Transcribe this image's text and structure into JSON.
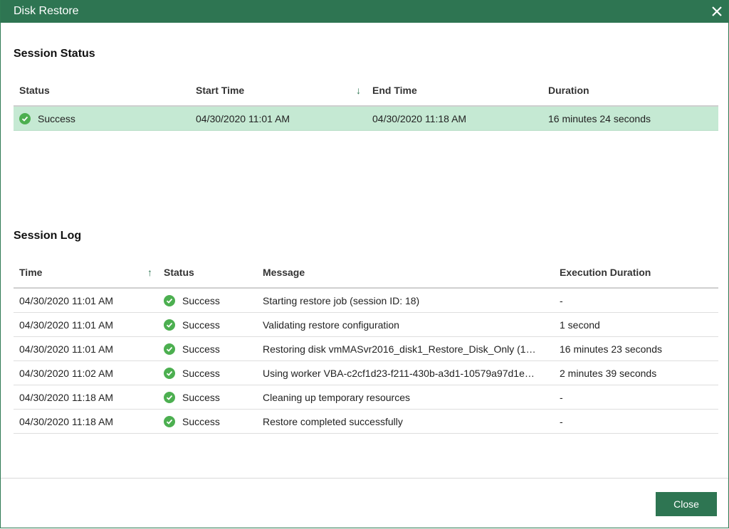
{
  "window": {
    "title": "Disk Restore"
  },
  "session_status": {
    "heading": "Session Status",
    "columns": [
      "Status",
      "Start Time",
      "End Time",
      "Duration"
    ],
    "rows": [
      {
        "status": "Success",
        "start": "04/30/2020 11:01 AM",
        "end": "04/30/2020 11:18 AM",
        "duration": "16 minutes 24 seconds"
      }
    ]
  },
  "session_log": {
    "heading": "Session Log",
    "columns": [
      "Time",
      "Status",
      "Message",
      "Execution Duration"
    ],
    "rows": [
      {
        "time": "04/30/2020 11:01 AM",
        "status": "Success",
        "message": "Starting restore job (session ID: 18)",
        "duration": "-"
      },
      {
        "time": "04/30/2020 11:01 AM",
        "status": "Success",
        "message": "Validating restore configuration",
        "duration": "1 second"
      },
      {
        "time": "04/30/2020 11:01 AM",
        "status": "Success",
        "message": "Restoring disk vmMASvr2016_disk1_Restore_Disk_Only (1…",
        "duration": "16 minutes 23 seconds"
      },
      {
        "time": "04/30/2020 11:02 AM",
        "status": "Success",
        "message": "Using worker VBA-c2cf1d23-f211-430b-a3d1-10579a97d1e…",
        "duration": "2 minutes 39 seconds"
      },
      {
        "time": "04/30/2020 11:18 AM",
        "status": "Success",
        "message": "Cleaning up temporary resources",
        "duration": "-"
      },
      {
        "time": "04/30/2020 11:18 AM",
        "status": "Success",
        "message": "Restore completed successfully",
        "duration": "-"
      }
    ]
  },
  "footer": {
    "close_label": "Close"
  },
  "colors": {
    "accent": "#2e7552",
    "success": "#4caf50",
    "selected_row": "#c5e9d3"
  }
}
